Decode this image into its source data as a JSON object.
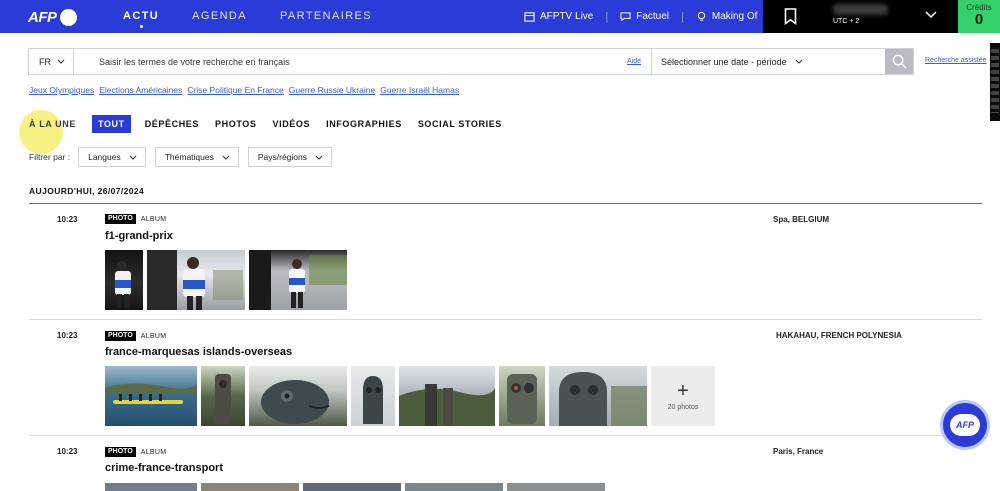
{
  "header": {
    "logo": "AFP",
    "nav": [
      "ACTU",
      "AGENDA",
      "PARTENAIRES"
    ],
    "links": [
      {
        "label": "AFPTV Live",
        "icon": "calendar-icon"
      },
      {
        "label": "Factuel",
        "icon": "chat-icon"
      },
      {
        "label": "Making Of",
        "icon": "lightbulb-icon"
      }
    ],
    "timezone": "UTC + 2",
    "credits_label": "Crédits",
    "credits_value": "0"
  },
  "search": {
    "language": "FR",
    "placeholder": "Saisir les termes de votre recherche en français",
    "help_link": "Aide",
    "date_placeholder": "Sélectionner une date - période",
    "advanced_link": "Recherche assistée"
  },
  "tags": [
    "Jeux Olympiques",
    "Elections Américaines",
    "Crise Politique En France",
    "Guerre Russie Ukraine",
    "Guerre Israël Hamas"
  ],
  "tabs": [
    "À LA UNE",
    "TOUT",
    "DÉPÊCHES",
    "PHOTOS",
    "VIDÉOS",
    "INFOGRAPHIES",
    "SOCIAL STORIES"
  ],
  "active_tab": "TOUT",
  "filters": {
    "label": "Filtrer par :",
    "options": [
      "Langues",
      "Thématiques",
      "Pays/régions"
    ]
  },
  "date_heading": "AUJOURD'HUI, 26/07/2024",
  "items": [
    {
      "time": "10:23",
      "type": "PHOTO",
      "kind": "ALBUM",
      "title": "f1-grand-prix",
      "location": "Spa, BELGIUM"
    },
    {
      "time": "10:23",
      "type": "PHOTO",
      "kind": "ALBUM",
      "title": "france-marquesas islands-overseas",
      "location": "HAKAHAU, FRENCH POLYNESIA",
      "more": "20 photos"
    },
    {
      "time": "10:23",
      "type": "PHOTO",
      "kind": "ALBUM",
      "title": "crime-france-transport",
      "location": "Paris, France"
    }
  ],
  "colors": {
    "brand": "#2b3bd8",
    "credits": "#34d06a",
    "link": "#3a5ad8"
  }
}
